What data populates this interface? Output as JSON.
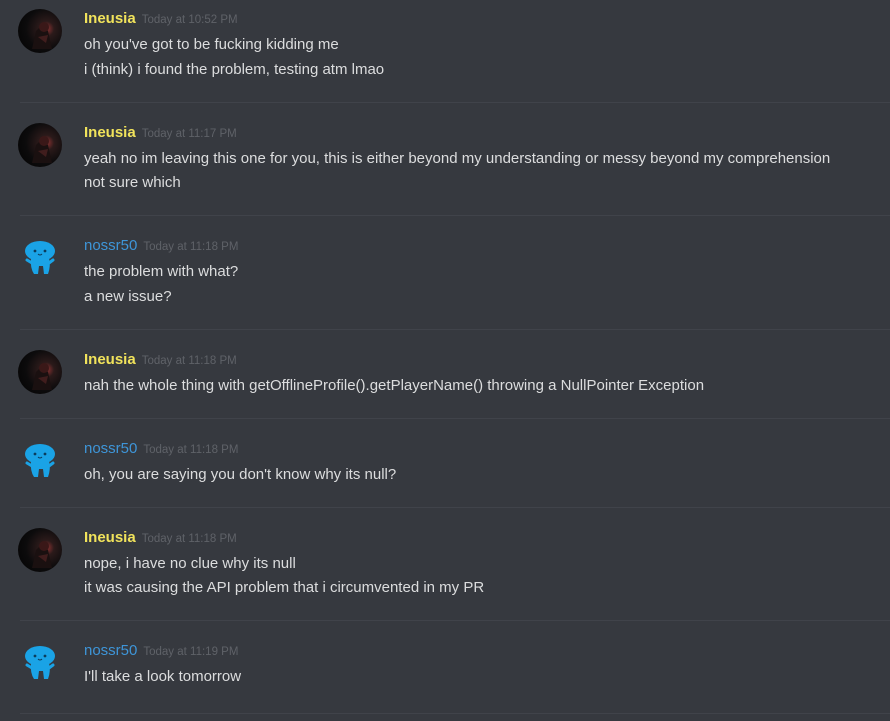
{
  "messages": [
    {
      "author": "Ineusia",
      "timestamp": "Today at 10:52 PM",
      "lines": [
        "oh you've got to be fucking kidding me",
        "i (think) i found the problem, testing atm lmao"
      ]
    },
    {
      "author": "Ineusia",
      "timestamp": "Today at 11:17 PM",
      "lines": [
        "yeah no im leaving this one for you, this is either beyond my understanding or messy beyond my comprehension",
        "not sure which"
      ]
    },
    {
      "author": "nossr50",
      "timestamp": "Today at 11:18 PM",
      "lines": [
        "the problem with what?",
        "a new issue?"
      ]
    },
    {
      "author": "Ineusia",
      "timestamp": "Today at 11:18 PM",
      "lines": [
        "nah the whole thing with getOfflineProfile().getPlayerName() throwing a NullPointer Exception"
      ]
    },
    {
      "author": "nossr50",
      "timestamp": "Today at 11:18 PM",
      "lines": [
        "oh, you are saying you don't know why its null?"
      ]
    },
    {
      "author": "Ineusia",
      "timestamp": "Today at 11:18 PM",
      "lines": [
        "nope, i have no clue why its null",
        "it was causing the API problem that i circumvented in my PR"
      ]
    },
    {
      "author": "nossr50",
      "timestamp": "Today at 11:19 PM",
      "lines": [
        "I'll take a look tomorrow"
      ]
    }
  ],
  "colors": {
    "background": "#36393f",
    "ineusia_name": "#f1e35b",
    "nossr50_name": "#3e95d8",
    "text": "#dcddde",
    "timestamp": "#5f6268"
  },
  "icons": {
    "ineusia_avatar": "dark-figure-avatar-icon",
    "nossr50_avatar": "blue-blob-avatar-icon"
  }
}
